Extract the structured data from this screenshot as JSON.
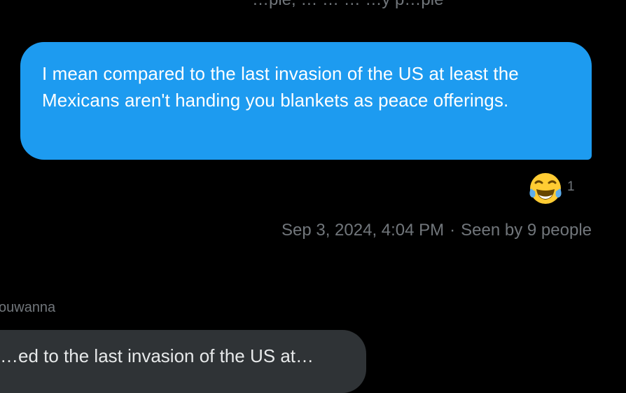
{
  "top_partial_text": "…ple, … … … …y p…ple",
  "outgoing_message": {
    "text": "I mean compared to the last invasion of the US at least the Mexicans aren't handing you blankets as peace offerings.",
    "bubble_color": "#1d9bf0"
  },
  "reaction": {
    "icon": "face-with-tears-of-joy-icon",
    "count": "1"
  },
  "meta": {
    "timestamp": "Sep 3, 2024, 4:04 PM",
    "separator": "·",
    "seen": "Seen by 9 people"
  },
  "incoming_message": {
    "sender": "ouwanna",
    "text": "…ed to the last invasion of the US at…",
    "bubble_color": "#2f3336"
  }
}
